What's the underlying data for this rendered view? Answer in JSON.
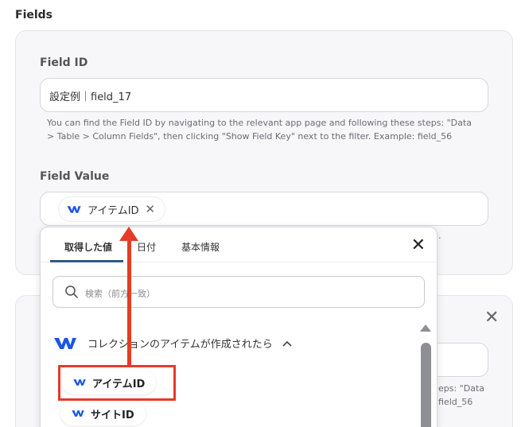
{
  "section": {
    "title": "Fields"
  },
  "field_id": {
    "label": "Field ID",
    "value": "設定例｜field_17",
    "help_line1": "You can find the Field ID by navigating to the relevant app page and following these steps: \"Data",
    "help_line2": "> Table > Column Fields\", then clicking \"Show Field Key\" next to the filter. Example: field_56"
  },
  "field_value": {
    "label": "Field Value",
    "chip": {
      "label": "アイテムID",
      "icon": "webflow-logo-icon",
      "close": "✕"
    },
    "help_tail": "."
  },
  "popup": {
    "tabs": [
      {
        "label": "取得した値",
        "active": true
      },
      {
        "label": "日付",
        "active": false
      },
      {
        "label": "基本情報",
        "active": false
      }
    ],
    "close": "✕",
    "search_placeholder": "検索（前方一致）",
    "group": {
      "title": "コレクションのアイテムが作成されたら",
      "chevron": "^",
      "icon": "webflow-logo-icon"
    },
    "items": [
      {
        "label": "アイテムID",
        "icon": "webflow-logo-icon"
      },
      {
        "label": "サイトID",
        "icon": "webflow-logo-icon"
      }
    ]
  },
  "card2": {
    "close": "✕",
    "help_line1_tail": "eps: \"Data",
    "help_line2_tail": "field_56"
  },
  "colors": {
    "annotation_red": "#e63b26",
    "webflow_blue": "#1b57e6",
    "tab_underline": "#2d5a86"
  }
}
